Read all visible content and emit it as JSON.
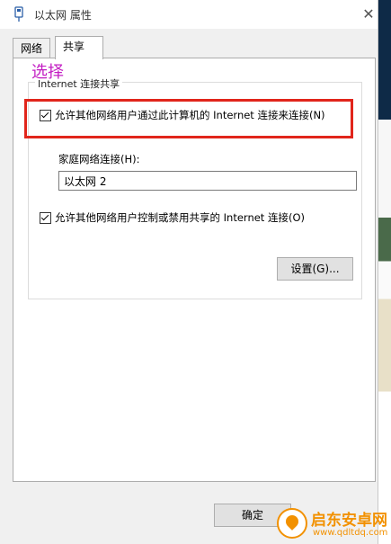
{
  "window": {
    "title": "以太网 属性",
    "close_glyph": "✕"
  },
  "tabs": [
    {
      "label": "网络",
      "active": false
    },
    {
      "label": "共享",
      "active": true
    }
  ],
  "sharing": {
    "group_label": "Internet 连接共享",
    "allow_share_label": "允许其他网络用户通过此计算机的 Internet 连接来连接(N)",
    "allow_share_checked": true,
    "home_network_label": "家庭网络连接(H):",
    "home_network_value": "以太网 2",
    "allow_control_label": "允许其他网络用户控制或禁用共享的 Internet 连接(O)",
    "allow_control_checked": true,
    "settings_button": "设置(G)..."
  },
  "footer": {
    "ok_button": "确定"
  },
  "annotation": {
    "text": "选择",
    "color": "#c31ec3",
    "box_color": "#e1251b"
  },
  "watermark": {
    "name": "启东安卓网",
    "url": "www.qdltdq.com",
    "color": "#f29100"
  }
}
